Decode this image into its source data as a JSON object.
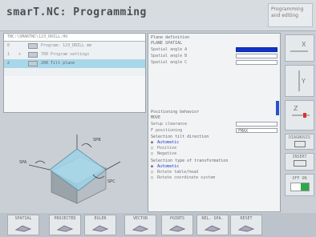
{
  "header": {
    "title": "smarT.NC: Programming",
    "mode": [
      "Programming",
      "and editing"
    ]
  },
  "tree": {
    "path": "TNC:\\SMARTNC\\123_DRILL.HU",
    "rows": [
      {
        "num": "0",
        "expander": "",
        "label": "Program: 123_DRILL mm"
      },
      {
        "num": "1",
        "expander": "+",
        "label": "700 Program settings"
      },
      {
        "num": "2",
        "expander": "",
        "label": "200 Tilt plane"
      }
    ]
  },
  "form": {
    "spatial": {
      "title": "Plane definition",
      "subtitle": "PLANE SPATIAL",
      "fields": [
        {
          "label": "Spatial angle A",
          "active": true
        },
        {
          "label": "Spatial angle B",
          "active": false
        },
        {
          "label": "Spatial angle C",
          "active": false
        }
      ]
    },
    "positioning": {
      "title": "Positioning behavior",
      "subtitle": "MOVE",
      "fields": [
        {
          "label": "Setup clearance",
          "value": ""
        },
        {
          "label": "F positioning",
          "value": "FMAX"
        }
      ]
    },
    "selection": {
      "title": "Selection tilt direction",
      "options": [
        {
          "label": "Automatic",
          "selected": true
        },
        {
          "label": "Positive",
          "selected": false
        },
        {
          "label": "Negative",
          "selected": false
        }
      ]
    },
    "transformation": {
      "title": "Selection type of transformation",
      "options": [
        {
          "label": "Automatic",
          "selected": true
        },
        {
          "label": "Rotate table/head",
          "selected": false
        },
        {
          "label": "Rotate coordinate system",
          "selected": false
        }
      ]
    }
  },
  "softkeys_right": [
    {
      "label": "X"
    },
    {
      "label": "Y"
    },
    {
      "label": "Z"
    },
    {
      "label": "DIAGNOSIS"
    },
    {
      "label": "INSERT"
    },
    {
      "label": "OFF ON"
    }
  ],
  "softkeys_bottom": [
    {
      "label": "SPATIAL"
    },
    {
      "label": "PROJECTED"
    },
    {
      "label": "EULER"
    },
    {
      "label": "VECTOR"
    },
    {
      "label": "POINTS"
    },
    {
      "label": "REL. SPA."
    },
    {
      "label": "RESET"
    }
  ],
  "colors": {
    "selection": "#a9d7ea",
    "active_field": "#1034c8",
    "accent_green": "#2fa84a"
  }
}
